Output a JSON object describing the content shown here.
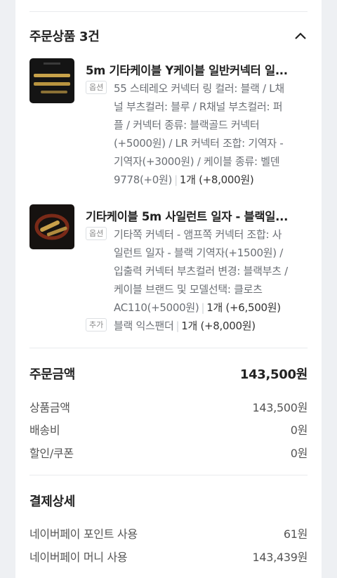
{
  "order_items": {
    "title": "주문상품 3건",
    "products": [
      {
        "name": "5m 기타케이블 Y케이블 일반커넥터 일...",
        "option_badge": "옵션",
        "option_lines": [
          "55 스테레오 커넥터 링 컬러: 블랙 / L채",
          "널 부츠컬러: 블루 / R채널 부츠컬러: 퍼",
          "플 / 커넥터 종류: 블랙골드 커넥터",
          "(+5000원) / LR 커넥터 조합: 기역자 -",
          "기역자(+3000원) / 케이블 종류: 벨덴",
          "9778(+0원)"
        ],
        "quantity": "1개 (+8,000원)"
      },
      {
        "name": "기타케이블 5m 사일런트 일자 - 블랙일...",
        "option_badge": "옵션",
        "option_lines": [
          "기타쪽 커넥터 - 앰프쪽 커넥터 조합: 사",
          "일런트 일자 - 블랙 기역자(+1500원) /",
          "입출력 커넥터 부츠컬러 변경: 블랙부츠 /",
          "케이블 브랜드 및 모델선택: 클로츠",
          "AC110(+5000원)"
        ],
        "quantity": "1개 (+6,500원)",
        "addon_badge": "추가",
        "addon_text": "블랙 익스팬더",
        "addon_quantity": "1개 (+8,000원)"
      }
    ]
  },
  "order_amount": {
    "title": "주문금액",
    "total": "143,500원",
    "rows": [
      {
        "label": "상품금액",
        "value": "143,500원"
      },
      {
        "label": "배송비",
        "value": "0원"
      },
      {
        "label": "할인/쿠폰",
        "value": "0원"
      }
    ]
  },
  "payment_detail": {
    "title": "결제상세",
    "rows": [
      {
        "label": "네이버페이 포인트 사용",
        "value": "61원"
      },
      {
        "label": "네이버페이 머니 사용",
        "value": "143,439원"
      }
    ]
  },
  "icons": {
    "collapse": "chevron-up-icon"
  },
  "colors": {
    "background": "#eef0f3",
    "card": "#ffffff",
    "divider": "#e9ebee",
    "muted_text": "#6b6f75"
  }
}
